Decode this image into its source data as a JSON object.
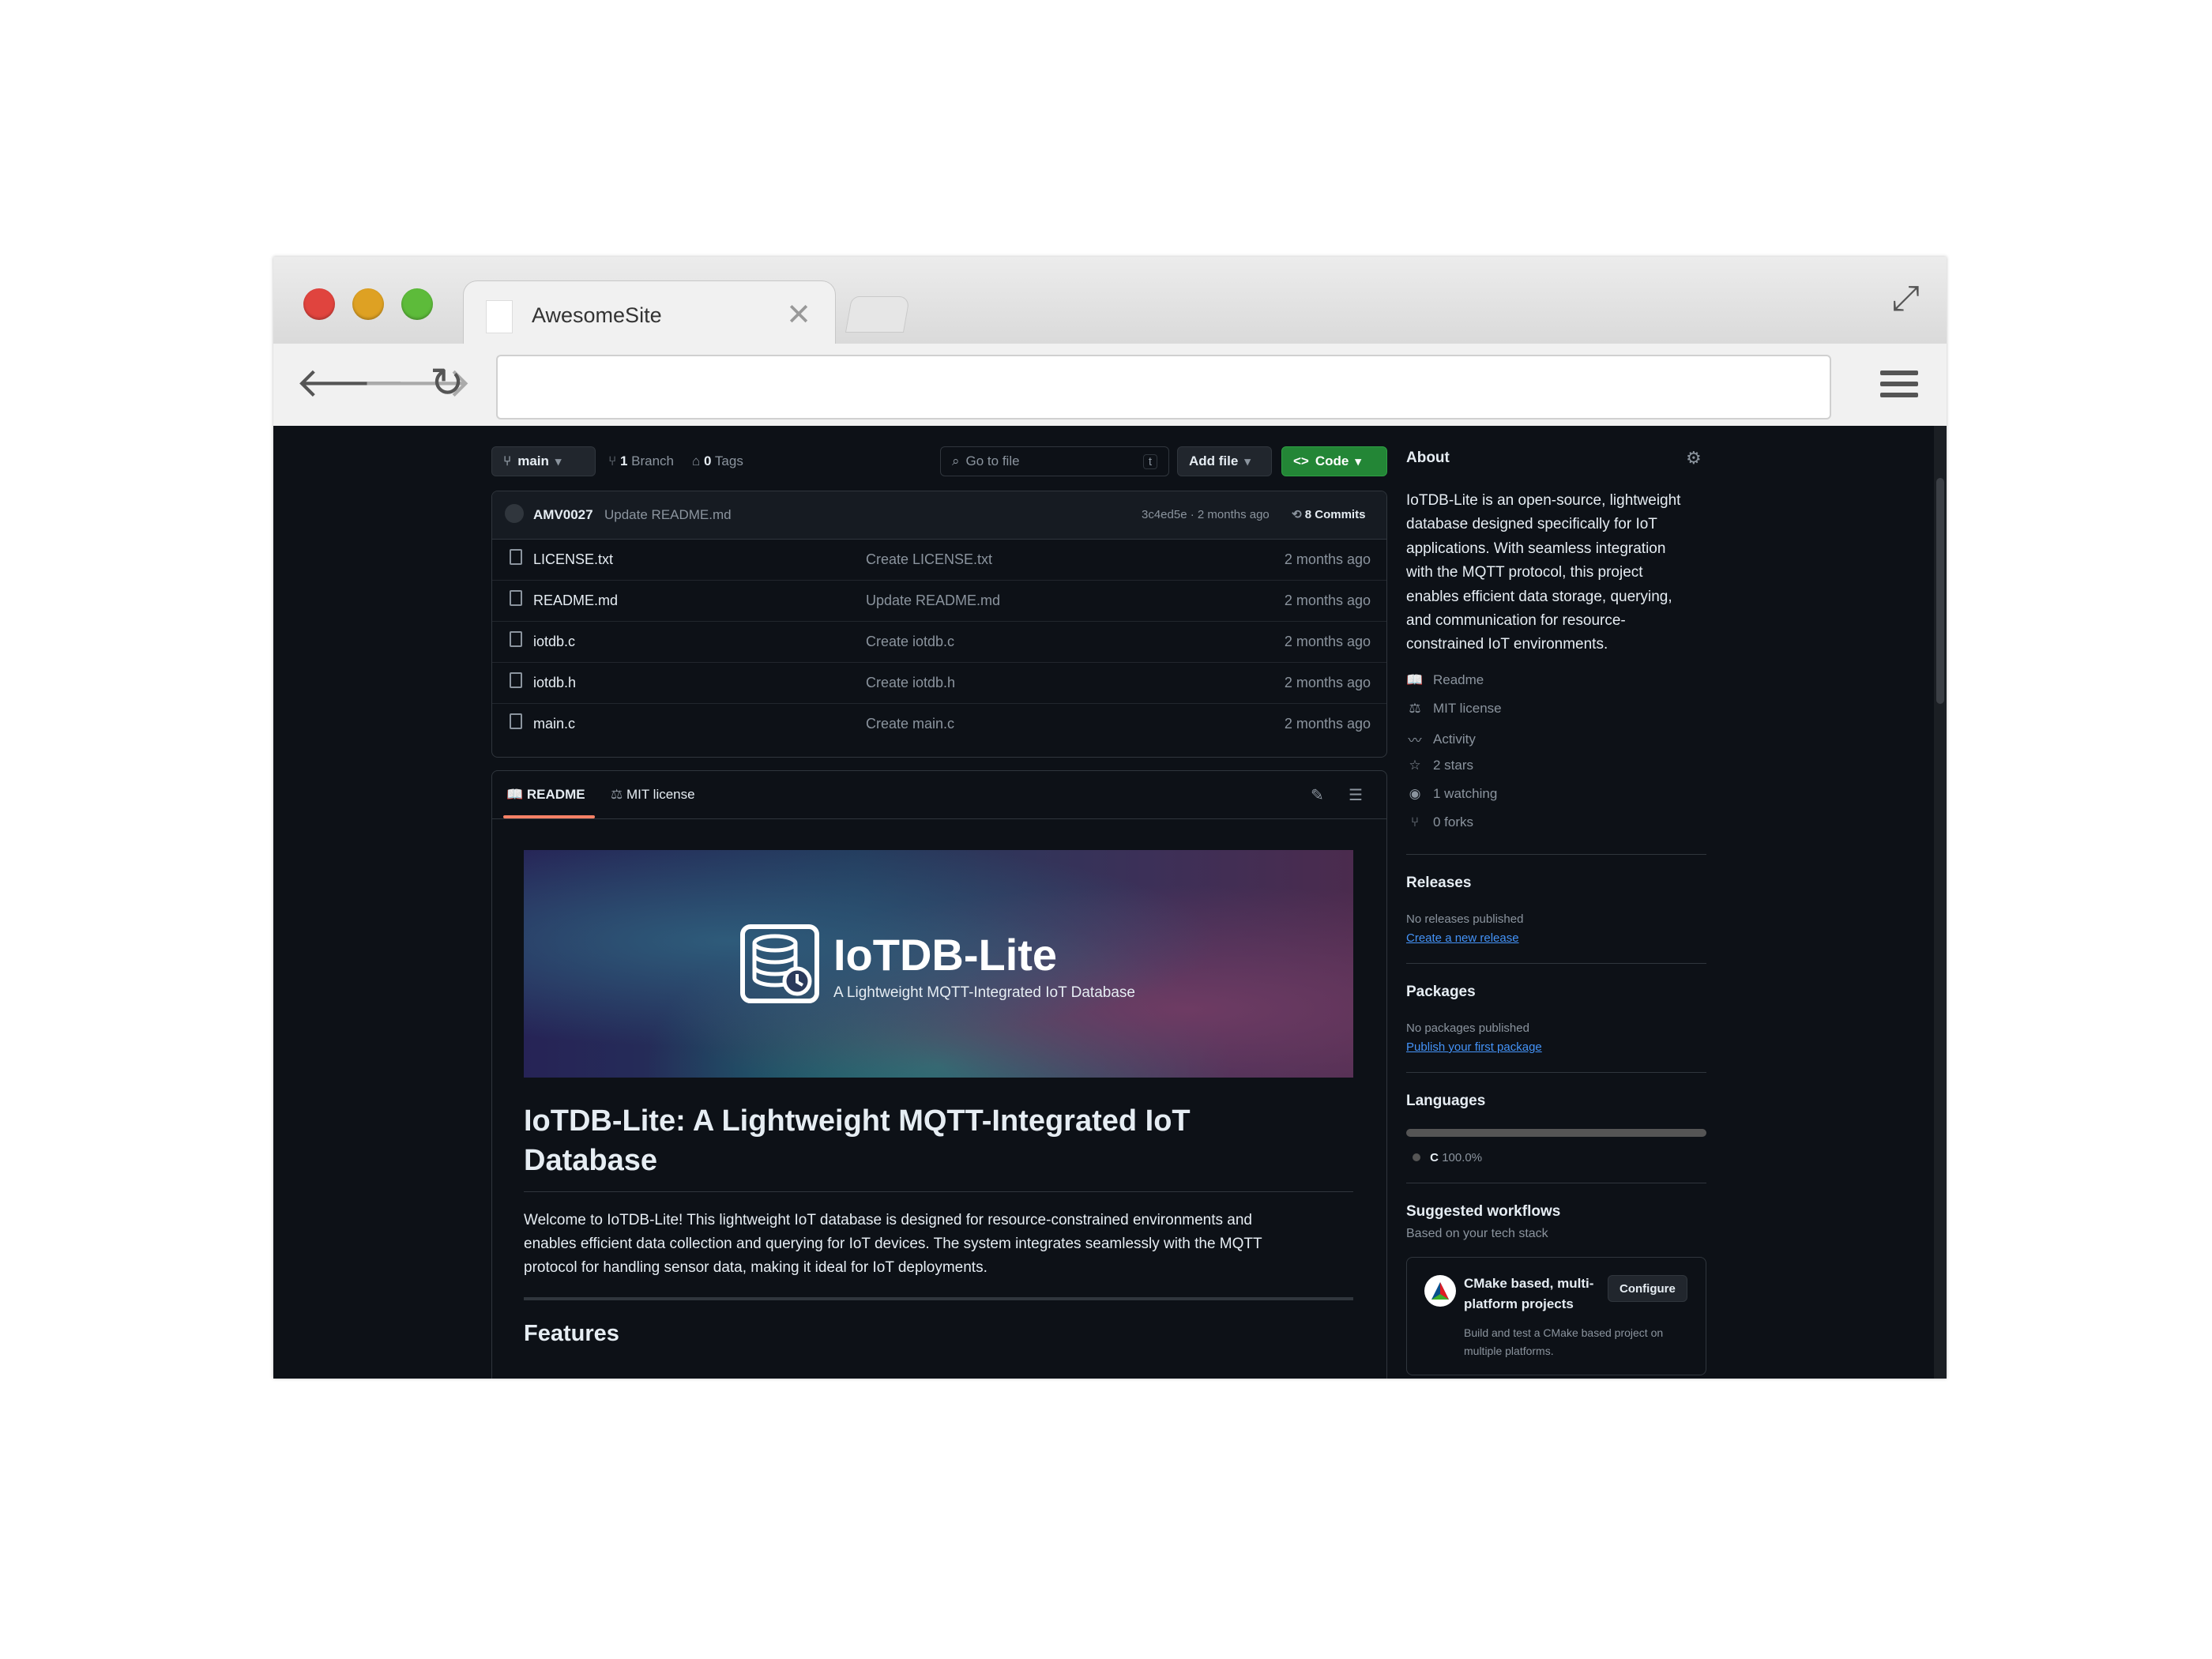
{
  "browser": {
    "tab_title": "AwesomeSite",
    "close_glyph": "✕",
    "back_glyph": "🡐",
    "forward_glyph": "🡒",
    "reload_glyph": "↻",
    "expand_glyph": "⤢",
    "address_value": ""
  },
  "repo_bar": {
    "branch_label": "main",
    "branches_count": "1",
    "branches_label": "Branch",
    "tags_count": "0",
    "tags_label": "Tags",
    "go_to_file_placeholder": "Go to file",
    "shortcut_key": "t",
    "add_file_label": "Add file",
    "code_label": "Code"
  },
  "latest_commit": {
    "author": "AMV0027",
    "message": "Update README.md",
    "hash_time": "3c4ed5e · 2 months ago",
    "commits_count": "8",
    "commits_label": "Commits"
  },
  "files": [
    {
      "name": "LICENSE.txt",
      "message": "Create LICENSE.txt",
      "time": "2 months ago"
    },
    {
      "name": "README.md",
      "message": "Update README.md",
      "time": "2 months ago"
    },
    {
      "name": "iotdb.c",
      "message": "Create iotdb.c",
      "time": "2 months ago"
    },
    {
      "name": "iotdb.h",
      "message": "Create iotdb.h",
      "time": "2 months ago"
    },
    {
      "name": "main.c",
      "message": "Create main.c",
      "time": "2 months ago"
    }
  ],
  "readme": {
    "tab_readme": "README",
    "tab_license": "MIT license",
    "banner_title": "IoTDB-Lite",
    "banner_subtitle": "A Lightweight MQTT-Integrated IoT Database",
    "heading_line1": "IoTDB-Lite: A Lightweight MQTT-Integrated IoT",
    "heading_line2": "Database",
    "intro_line1": "Welcome to IoTDB-Lite! This lightweight IoT database is designed for resource-constrained environments and",
    "intro_line2": "enables efficient data collection and querying for IoT devices. The system integrates seamlessly with the MQTT",
    "intro_line3": "protocol for handling sensor data, making it ideal for IoT deployments.",
    "features_heading": "Features"
  },
  "about": {
    "title": "About",
    "desc_lines": [
      "IoTDB-Lite is an open-source, lightweight",
      "database designed specifically for IoT",
      "applications. With seamless integration",
      "with the MQTT protocol, this project",
      "enables efficient data storage, querying,",
      "and communication for resource-",
      "constrained IoT environments."
    ],
    "items": [
      {
        "icon": "book-icon",
        "glyph": "📖",
        "label": "Readme"
      },
      {
        "icon": "scale-icon",
        "glyph": "⚖",
        "label": "MIT license"
      },
      {
        "icon": "activity-icon",
        "glyph": "〰",
        "label": "Activity"
      },
      {
        "icon": "star-icon",
        "glyph": "☆",
        "label": "2 stars"
      },
      {
        "icon": "eye-icon",
        "glyph": "◉",
        "label": "1 watching"
      },
      {
        "icon": "fork-icon",
        "glyph": "⑂",
        "label": "0 forks"
      }
    ]
  },
  "releases": {
    "title": "Releases",
    "empty": "No releases published",
    "link": "Create a new release"
  },
  "packages": {
    "title": "Packages",
    "empty": "No packages published",
    "link": "Publish your first package"
  },
  "languages": {
    "title": "Languages",
    "name": "C",
    "percent": "100.0%",
    "fraction": 1.0,
    "color": "#555555"
  },
  "workflows": {
    "title": "Suggested workflows",
    "subtitle": "Based on your tech stack",
    "card_title_line1": "CMake based, multi-",
    "card_title_line2": "platform projects",
    "configure_label": "Configure",
    "card_desc_line1": "Build and test a CMake based project on",
    "card_desc_line2": "multiple platforms."
  },
  "colors": {
    "accent_green": "#238636",
    "link_blue": "#4493f8",
    "tab_underline": "#f78166",
    "bg": "#0d1117"
  }
}
